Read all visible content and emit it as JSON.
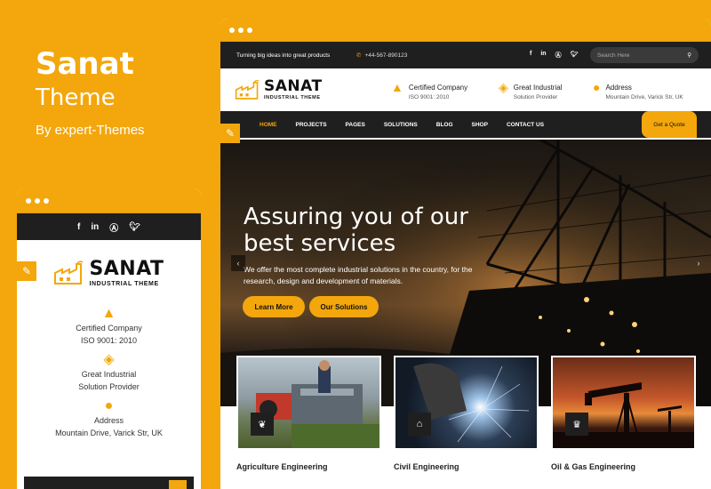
{
  "promo": {
    "title": "Sanat",
    "subtitle": "Theme",
    "byline": "By expert-Themes"
  },
  "brand": {
    "name": "SANAT",
    "tagline": "INDUSTRIAL THEME"
  },
  "social": {
    "facebook": "f",
    "linkedin": "in",
    "skype": "Ⓢ",
    "twitter": "❚"
  },
  "mobile": {
    "info": [
      {
        "icon": "certificate-icon",
        "title": "Certified Company",
        "sub": "ISO 9001: 2010"
      },
      {
        "icon": "trophy-icon",
        "title": "Great Industrial",
        "sub": "Solution Provider"
      },
      {
        "icon": "globe-icon",
        "title": "Address",
        "sub": "Mountain Drive, Varick Str, UK"
      }
    ]
  },
  "topbar": {
    "tagline": "Turning big ideas into great products",
    "phone": "+44-567-890123",
    "search_placeholder": "Search Here"
  },
  "header_info": [
    {
      "title": "Certified Company",
      "sub": "ISO 9001: 2010"
    },
    {
      "title": "Great Industrial",
      "sub": "Solution Provider"
    },
    {
      "title": "Address",
      "sub": "Mountain Drive, Varick Str, UK"
    }
  ],
  "nav": {
    "items": [
      "HOME",
      "PROJECTS",
      "PAGES",
      "SOLUTIONS",
      "BLOG",
      "SHOP",
      "CONTACT US"
    ],
    "active": "HOME",
    "quote": "Get a Quote"
  },
  "slide": {
    "heading_line1": "Assuring you of our",
    "heading_line2": "best services",
    "text": "We offer the most complete industrial solutions in the country, for the research, design and development of materials.",
    "btn1": "Learn More",
    "btn2": "Our Solutions"
  },
  "cards": [
    {
      "title": "Agriculture Engineering",
      "icon": "leaf-icon"
    },
    {
      "title": "Civil Engineering",
      "icon": "home-icon"
    },
    {
      "title": "Oil & Gas Engineering",
      "icon": "fire-extinguisher-icon"
    }
  ],
  "colors": {
    "accent": "#f3a70c",
    "dark": "#1f1f1f"
  }
}
